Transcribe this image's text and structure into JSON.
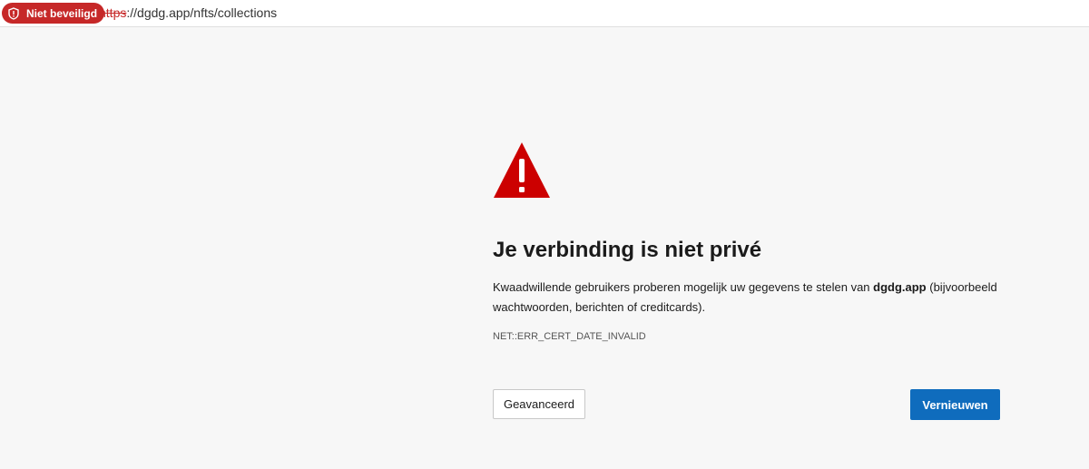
{
  "address_bar": {
    "security_label": "Niet beveiligd",
    "url_scheme": "https",
    "url_rest": "://dgdg.app/nfts/collections",
    "icon": "shield-icon"
  },
  "error_page": {
    "icon": "warning-triangle-icon",
    "title": "Je verbinding is niet privé",
    "description_before": "Kwaadwillende gebruikers proberen mogelijk uw gegevens te stelen van ",
    "domain": "dgdg.app",
    "description_after": " (bijvoorbeeld wachtwoorden, berichten of creditcards).",
    "error_code": "NET::ERR_CERT_DATE_INVALID",
    "advanced_button": "Geavanceerd",
    "reload_button": "Vernieuwen"
  },
  "colors": {
    "danger": "#c62828",
    "warning_icon": "#cc0000",
    "primary_button": "#0f6cbd",
    "background": "#f7f7f7"
  }
}
